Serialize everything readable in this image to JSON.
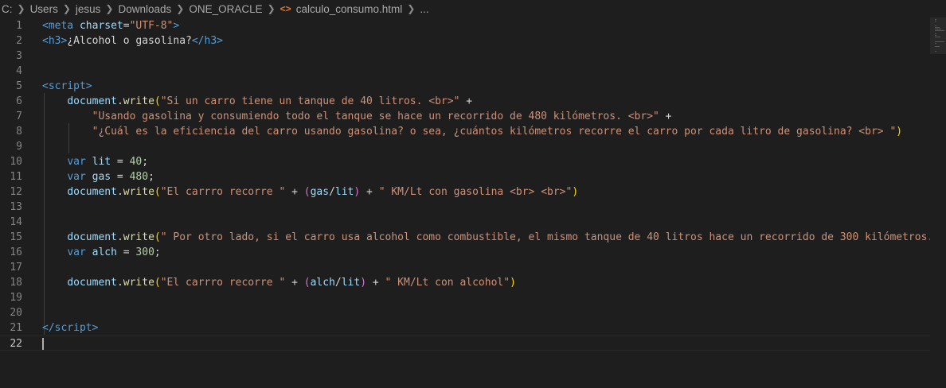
{
  "breadcrumb": {
    "items": [
      "C:",
      "Users",
      "jesus",
      "Downloads",
      "ONE_ORACLE",
      "calculo_consumo.html",
      "..."
    ],
    "file_icon": "html-file-icon"
  },
  "editor": {
    "current_line": 22,
    "lines": [
      {
        "n": "1",
        "tokens": [
          [
            "tag",
            "<"
          ],
          [
            "tag",
            "meta"
          ],
          [
            "txt",
            " "
          ],
          [
            "attr",
            "charset"
          ],
          [
            "txt",
            "="
          ],
          [
            "str",
            "\"UTF-8\""
          ],
          [
            "tag",
            ">"
          ]
        ]
      },
      {
        "n": "2",
        "tokens": [
          [
            "tag",
            "<"
          ],
          [
            "tag",
            "h3"
          ],
          [
            "tag",
            ">"
          ],
          [
            "txt",
            "¿Alcohol o gasolina?"
          ],
          [
            "tag",
            "</"
          ],
          [
            "tag",
            "h3"
          ],
          [
            "tag",
            ">"
          ]
        ]
      },
      {
        "n": "3",
        "tokens": []
      },
      {
        "n": "4",
        "tokens": []
      },
      {
        "n": "5",
        "tokens": [
          [
            "tag",
            "<"
          ],
          [
            "tag",
            "script"
          ],
          [
            "tag",
            ">"
          ]
        ]
      },
      {
        "n": "6",
        "tokens": [
          [
            "txt",
            "    "
          ],
          [
            "var",
            "document"
          ],
          [
            "txt",
            "."
          ],
          [
            "fn",
            "write"
          ],
          [
            "brk",
            "("
          ],
          [
            "str",
            "\"Si un carro tiene un tanque de 40 litros. <br>\""
          ],
          [
            "txt",
            " +"
          ]
        ]
      },
      {
        "n": "7",
        "tokens": [
          [
            "txt",
            "        "
          ],
          [
            "str",
            "\"Usando gasolina y consumiendo todo el tanque se hace un recorrido de 480 kilómetros. <br>\""
          ],
          [
            "txt",
            " +"
          ]
        ]
      },
      {
        "n": "8",
        "tokens": [
          [
            "txt",
            "        "
          ],
          [
            "str",
            "\"¿Cuál es la eficiencia del carro usando gasolina? o sea, ¿cuántos kilómetros recorre el carro por cada litro de gasolina? <br> \""
          ],
          [
            "brk",
            ")"
          ]
        ]
      },
      {
        "n": "9",
        "tokens": []
      },
      {
        "n": "10",
        "tokens": [
          [
            "txt",
            "    "
          ],
          [
            "kw",
            "var"
          ],
          [
            "txt",
            " "
          ],
          [
            "var",
            "lit"
          ],
          [
            "txt",
            " = "
          ],
          [
            "num",
            "40"
          ],
          [
            "txt",
            ";"
          ]
        ]
      },
      {
        "n": "11",
        "tokens": [
          [
            "txt",
            "    "
          ],
          [
            "kw",
            "var"
          ],
          [
            "txt",
            " "
          ],
          [
            "var",
            "gas"
          ],
          [
            "txt",
            " = "
          ],
          [
            "num",
            "480"
          ],
          [
            "txt",
            ";"
          ]
        ]
      },
      {
        "n": "12",
        "tokens": [
          [
            "txt",
            "    "
          ],
          [
            "var",
            "document"
          ],
          [
            "txt",
            "."
          ],
          [
            "fn",
            "write"
          ],
          [
            "brk",
            "("
          ],
          [
            "str",
            "\"El carrro recorre \""
          ],
          [
            "txt",
            " + "
          ],
          [
            "brk2",
            "("
          ],
          [
            "var",
            "gas"
          ],
          [
            "txt",
            "/"
          ],
          [
            "var",
            "lit"
          ],
          [
            "brk2",
            ")"
          ],
          [
            "txt",
            " + "
          ],
          [
            "str",
            "\" KM/Lt con gasolina <br> <br>\""
          ],
          [
            "brk",
            ")"
          ]
        ]
      },
      {
        "n": "13",
        "tokens": []
      },
      {
        "n": "14",
        "tokens": []
      },
      {
        "n": "15",
        "tokens": [
          [
            "txt",
            "    "
          ],
          [
            "var",
            "document"
          ],
          [
            "txt",
            "."
          ],
          [
            "fn",
            "write"
          ],
          [
            "brk",
            "("
          ],
          [
            "str",
            "\" Por otro lado, si el carro usa alcohol como combustible, el mismo tanque de 40 litros hace un recorrido de 300 kilómetros. <"
          ]
        ]
      },
      {
        "n": "16",
        "tokens": [
          [
            "txt",
            "    "
          ],
          [
            "kw",
            "var"
          ],
          [
            "txt",
            " "
          ],
          [
            "var",
            "alch"
          ],
          [
            "txt",
            " = "
          ],
          [
            "num",
            "300"
          ],
          [
            "txt",
            ";"
          ]
        ]
      },
      {
        "n": "17",
        "tokens": []
      },
      {
        "n": "18",
        "tokens": [
          [
            "txt",
            "    "
          ],
          [
            "var",
            "document"
          ],
          [
            "txt",
            "."
          ],
          [
            "fn",
            "write"
          ],
          [
            "brk",
            "("
          ],
          [
            "str",
            "\"El carrro recorre \""
          ],
          [
            "txt",
            " + "
          ],
          [
            "brk2",
            "("
          ],
          [
            "var",
            "alch"
          ],
          [
            "txt",
            "/"
          ],
          [
            "var",
            "lit"
          ],
          [
            "brk2",
            ")"
          ],
          [
            "txt",
            " + "
          ],
          [
            "str",
            "\" KM/Lt con alcohol\""
          ],
          [
            "brk",
            ")"
          ]
        ]
      },
      {
        "n": "19",
        "tokens": []
      },
      {
        "n": "20",
        "tokens": []
      },
      {
        "n": "21",
        "tokens": [
          [
            "tag",
            "</"
          ],
          [
            "tag",
            "script"
          ],
          [
            "tag",
            ">"
          ]
        ]
      },
      {
        "n": "22",
        "tokens": []
      }
    ]
  }
}
